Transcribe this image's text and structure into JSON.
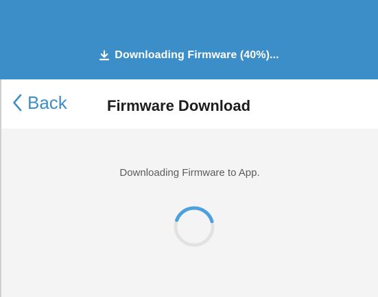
{
  "banner": {
    "icon": "download-icon",
    "text": "Downloading Firmware (40%)...",
    "background_color": "#3c8ec8"
  },
  "nav": {
    "back_icon": "chevron-left-icon",
    "back_label": "Back",
    "title": "Firmware Download",
    "accent_color": "#3c8ec8"
  },
  "content": {
    "message": "Downloading Firmware to App.",
    "spinner_icon": "loading-spinner-icon"
  },
  "progress": {
    "percent": 40
  }
}
